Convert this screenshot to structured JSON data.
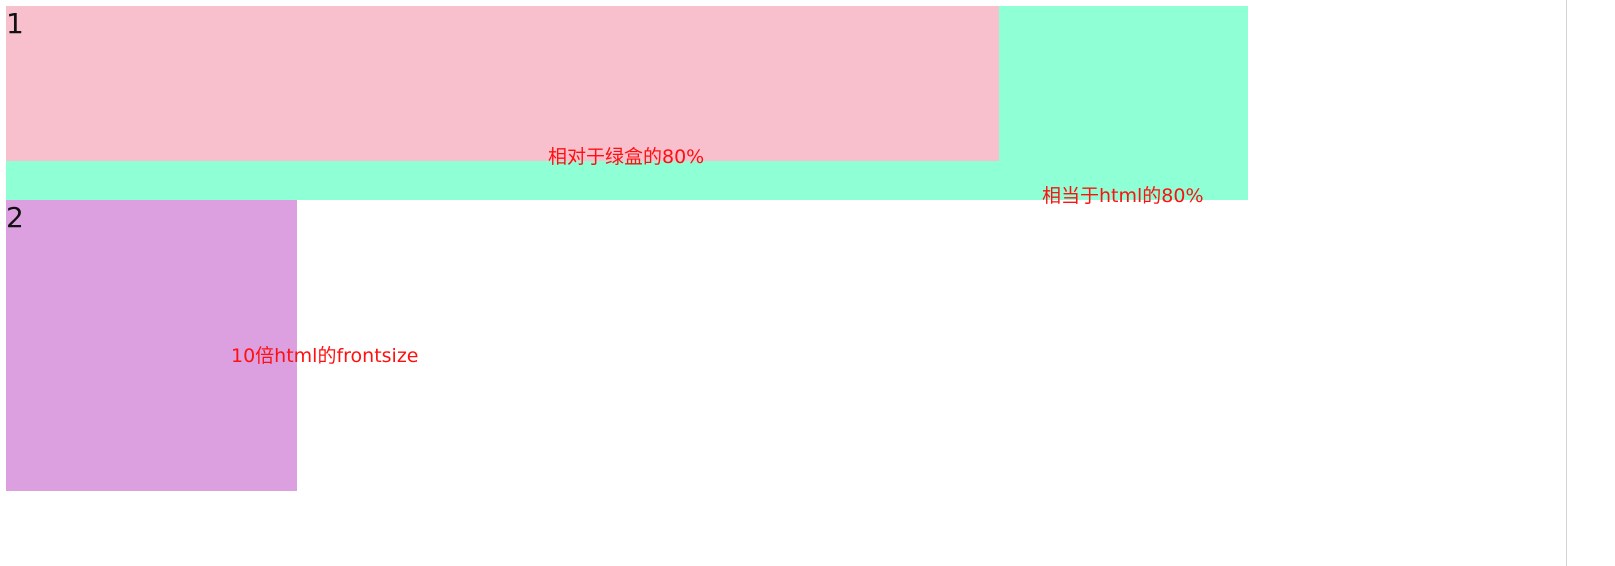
{
  "boxes": {
    "green": {
      "color": "#8fffd6"
    },
    "pink": {
      "label": "1",
      "color": "#f8bfcd"
    },
    "purple": {
      "label": "2",
      "color": "#dc9fe0"
    }
  },
  "annotations": {
    "pink_note": "相对于绿盒的80%",
    "green_note": "相当于html的80%",
    "purple_note": "10倍html的frontsize"
  },
  "annotation_color": "#ff1010"
}
